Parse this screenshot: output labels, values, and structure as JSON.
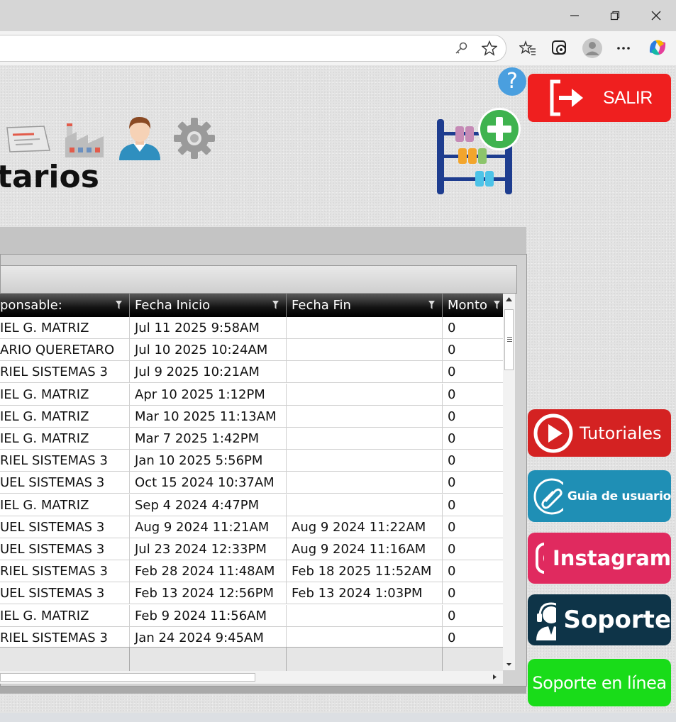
{
  "browser": {
    "window_controls": [
      "minimize",
      "restore",
      "close"
    ],
    "toolbar_icons": [
      "key-icon",
      "star-icon",
      "favorites-icon",
      "collections-icon",
      "profile-icon",
      "more-icon",
      "copilot-icon"
    ]
  },
  "header": {
    "title": "tarios",
    "help_label": "?",
    "exit_label": "SALIR"
  },
  "grid": {
    "columns": [
      "ponsable:",
      "Fecha Inicio",
      "Fecha Fin",
      "Monto"
    ],
    "rows": [
      [
        "IEL G. MATRIZ",
        "Jul 11 2025  9:58AM",
        "",
        "0"
      ],
      [
        "ARIO QUERETARO",
        "Jul 10 2025 10:24AM",
        "",
        "0"
      ],
      [
        "RIEL SISTEMAS 3",
        "Jul  9 2025 10:21AM",
        "",
        "0"
      ],
      [
        "IEL G. MATRIZ",
        "Apr 10 2025  1:12PM",
        "",
        "0"
      ],
      [
        "IEL G. MATRIZ",
        "Mar 10 2025 11:13AM",
        "",
        "0"
      ],
      [
        "IEL G. MATRIZ",
        "Mar  7 2025  1:42PM",
        "",
        "0"
      ],
      [
        "RIEL SISTEMAS 3",
        "Jan 10 2025  5:56PM",
        "",
        "0"
      ],
      [
        "UEL SISTEMAS 3",
        "Oct 15 2024 10:37AM",
        "",
        "0"
      ],
      [
        "IEL G. MATRIZ",
        "Sep  4 2024  4:47PM",
        "",
        "0"
      ],
      [
        "UEL SISTEMAS 3",
        "Aug  9 2024 11:21AM",
        "Aug  9 2024 11:22AM",
        "0"
      ],
      [
        "UEL SISTEMAS 3",
        "Jul 23 2024 12:33PM",
        "Aug  9 2024 11:16AM",
        "0"
      ],
      [
        "RIEL SISTEMAS 3",
        "Feb 28 2024 11:48AM",
        "Feb 18 2025 11:52AM",
        "0"
      ],
      [
        "UEL SISTEMAS 3",
        "Feb 13 2024 12:56PM",
        "Feb 13 2024  1:03PM",
        "0"
      ],
      [
        "IEL G. MATRIZ",
        "Feb  9 2024 11:56AM",
        "",
        "0"
      ],
      [
        "RIEL SISTEMAS 3",
        "Jan 24 2024  9:45AM",
        "",
        "0"
      ]
    ]
  },
  "side": {
    "tutoriales": "Tutoriales",
    "guia": "Guia de usuario",
    "instagram": "Instagram",
    "soporte": "Soporte",
    "soporte_linea": "Soporte en línea"
  },
  "colors": {
    "salir": "#ef1f1f",
    "tutoriales": "#d42222",
    "guia": "#1f8fb5",
    "instagram": "#e02a5f",
    "soporte": "#0e3448",
    "soporte_linea": "#19dc19"
  }
}
